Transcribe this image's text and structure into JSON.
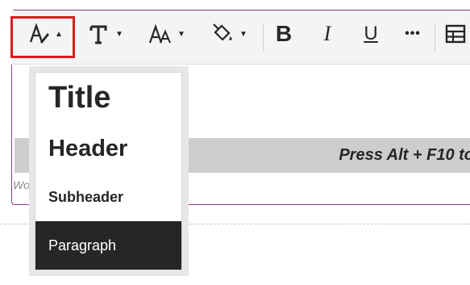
{
  "toolbar": {
    "buttons": [
      {
        "name": "text-style"
      },
      {
        "name": "font-family"
      },
      {
        "name": "font-size"
      },
      {
        "name": "text-color"
      },
      {
        "name": "bold",
        "label": "B"
      },
      {
        "name": "italic",
        "label": "I"
      },
      {
        "name": "underline",
        "label": "U"
      },
      {
        "name": "more",
        "label": "•••"
      },
      {
        "name": "table"
      }
    ]
  },
  "editor": {
    "hint_text": "Press Alt + F10 to",
    "footer_text": "Wo",
    "cursor_glyph": "T"
  },
  "style_menu": {
    "items": [
      {
        "label": "Title"
      },
      {
        "label": "Header"
      },
      {
        "label": "Subheader"
      },
      {
        "label": "Paragraph",
        "selected": true
      }
    ]
  },
  "colors": {
    "accent_border": "#8e3a8e",
    "highlight": "#e0191f",
    "selected_item_bg": "#262626"
  }
}
